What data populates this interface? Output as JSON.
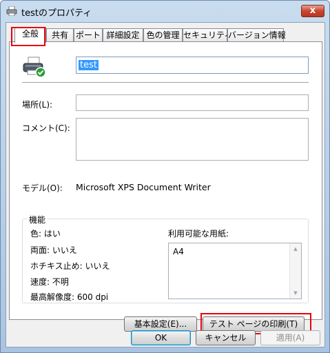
{
  "window": {
    "title": "testのプロパティ",
    "close_label": "x"
  },
  "tabs": [
    {
      "label": "全般"
    },
    {
      "label": "共有"
    },
    {
      "label": "ポート"
    },
    {
      "label": "詳細設定"
    },
    {
      "label": "色の管理"
    },
    {
      "label": "セキュリティ"
    },
    {
      "label": "バージョン情報"
    }
  ],
  "general": {
    "printer_name": "test",
    "location_label": "場所(L):",
    "location_value": "",
    "comment_label": "コメント(C):",
    "comment_value": "",
    "model_label": "モデル(O):",
    "model_value": "Microsoft XPS Document Writer",
    "features": {
      "title": "機能",
      "color": "色: はい",
      "duplex": "両面: いいえ",
      "staple": "ホチキス止め: いいえ",
      "speed": "速度: 不明",
      "resolution": "最高解像度: 600 dpi",
      "paper_label": "利用可能な用紙:",
      "paper_items": [
        "A4"
      ]
    },
    "preferences_button": "基本設定(E)...",
    "print_test_button": "テスト ページの印刷(T)"
  },
  "footer": {
    "ok": "OK",
    "cancel": "キャンセル",
    "apply": "適用(A)"
  },
  "colors": {
    "highlight": "#e8000b",
    "selection": "#3399ff"
  }
}
